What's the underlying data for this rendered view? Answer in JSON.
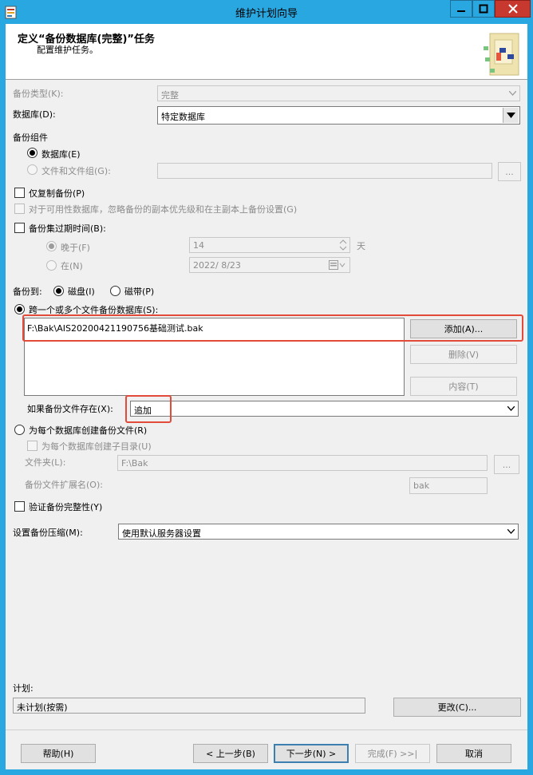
{
  "window": {
    "title": "维护计划向导"
  },
  "header": {
    "title": "定义“备份数据库(完整)”任务",
    "subtitle": "配置维护任务。"
  },
  "form": {
    "backup_type": {
      "label": "备份类型(K):",
      "value": "完整"
    },
    "database": {
      "label": "数据库(D):",
      "value": "特定数据库"
    },
    "backup_component": {
      "label": "备份组件",
      "database_option": "数据库(E)",
      "files_option": "文件和文件组(G):",
      "browse_label": "..."
    },
    "copy_only": "仅复制备份(P)",
    "availability": "对于可用性数据库，忽略备份的副本优先级和在主副本上备份设置(G)",
    "expire": {
      "label": "备份集过期时间(B):",
      "after_label": "晚于(F)",
      "after_value": "14",
      "after_unit": "天",
      "on_label": "在(N)",
      "on_value": "2022/ 8/23"
    },
    "backup_to": {
      "label": "备份到:",
      "disk": "磁盘(I)",
      "tape": "磁带(P)"
    },
    "span_files": {
      "label": "跨一个或多个文件备份数据库(S):",
      "files": [
        "F:\\Bak\\AIS20200421190756基础测试.bak"
      ],
      "add_button": "添加(A)...",
      "remove_button": "删除(V)",
      "contents_button": "内容(T)",
      "if_exists_label": "如果备份文件存在(X):",
      "if_exists_value": "追加"
    },
    "per_db": {
      "label": "为每个数据库创建备份文件(R)",
      "subdir": "为每个数据库创建子目录(U)",
      "folder_label": "文件夹(L):",
      "folder_value": "F:\\Bak",
      "browse_label": "...",
      "ext_label": "备份文件扩展名(O):",
      "ext_value": "bak"
    },
    "verify": "验证备份完整性(Y)",
    "compression": {
      "label": "设置备份压缩(M):",
      "value": "使用默认服务器设置"
    }
  },
  "schedule": {
    "label": "计划:",
    "value": "未计划(按需)",
    "change_button": "更改(C)..."
  },
  "footer": {
    "help": "帮助(H)",
    "back": "< 上一步(B)",
    "next": "下一步(N) >",
    "finish": "完成(F) >>|",
    "cancel": "取消"
  }
}
